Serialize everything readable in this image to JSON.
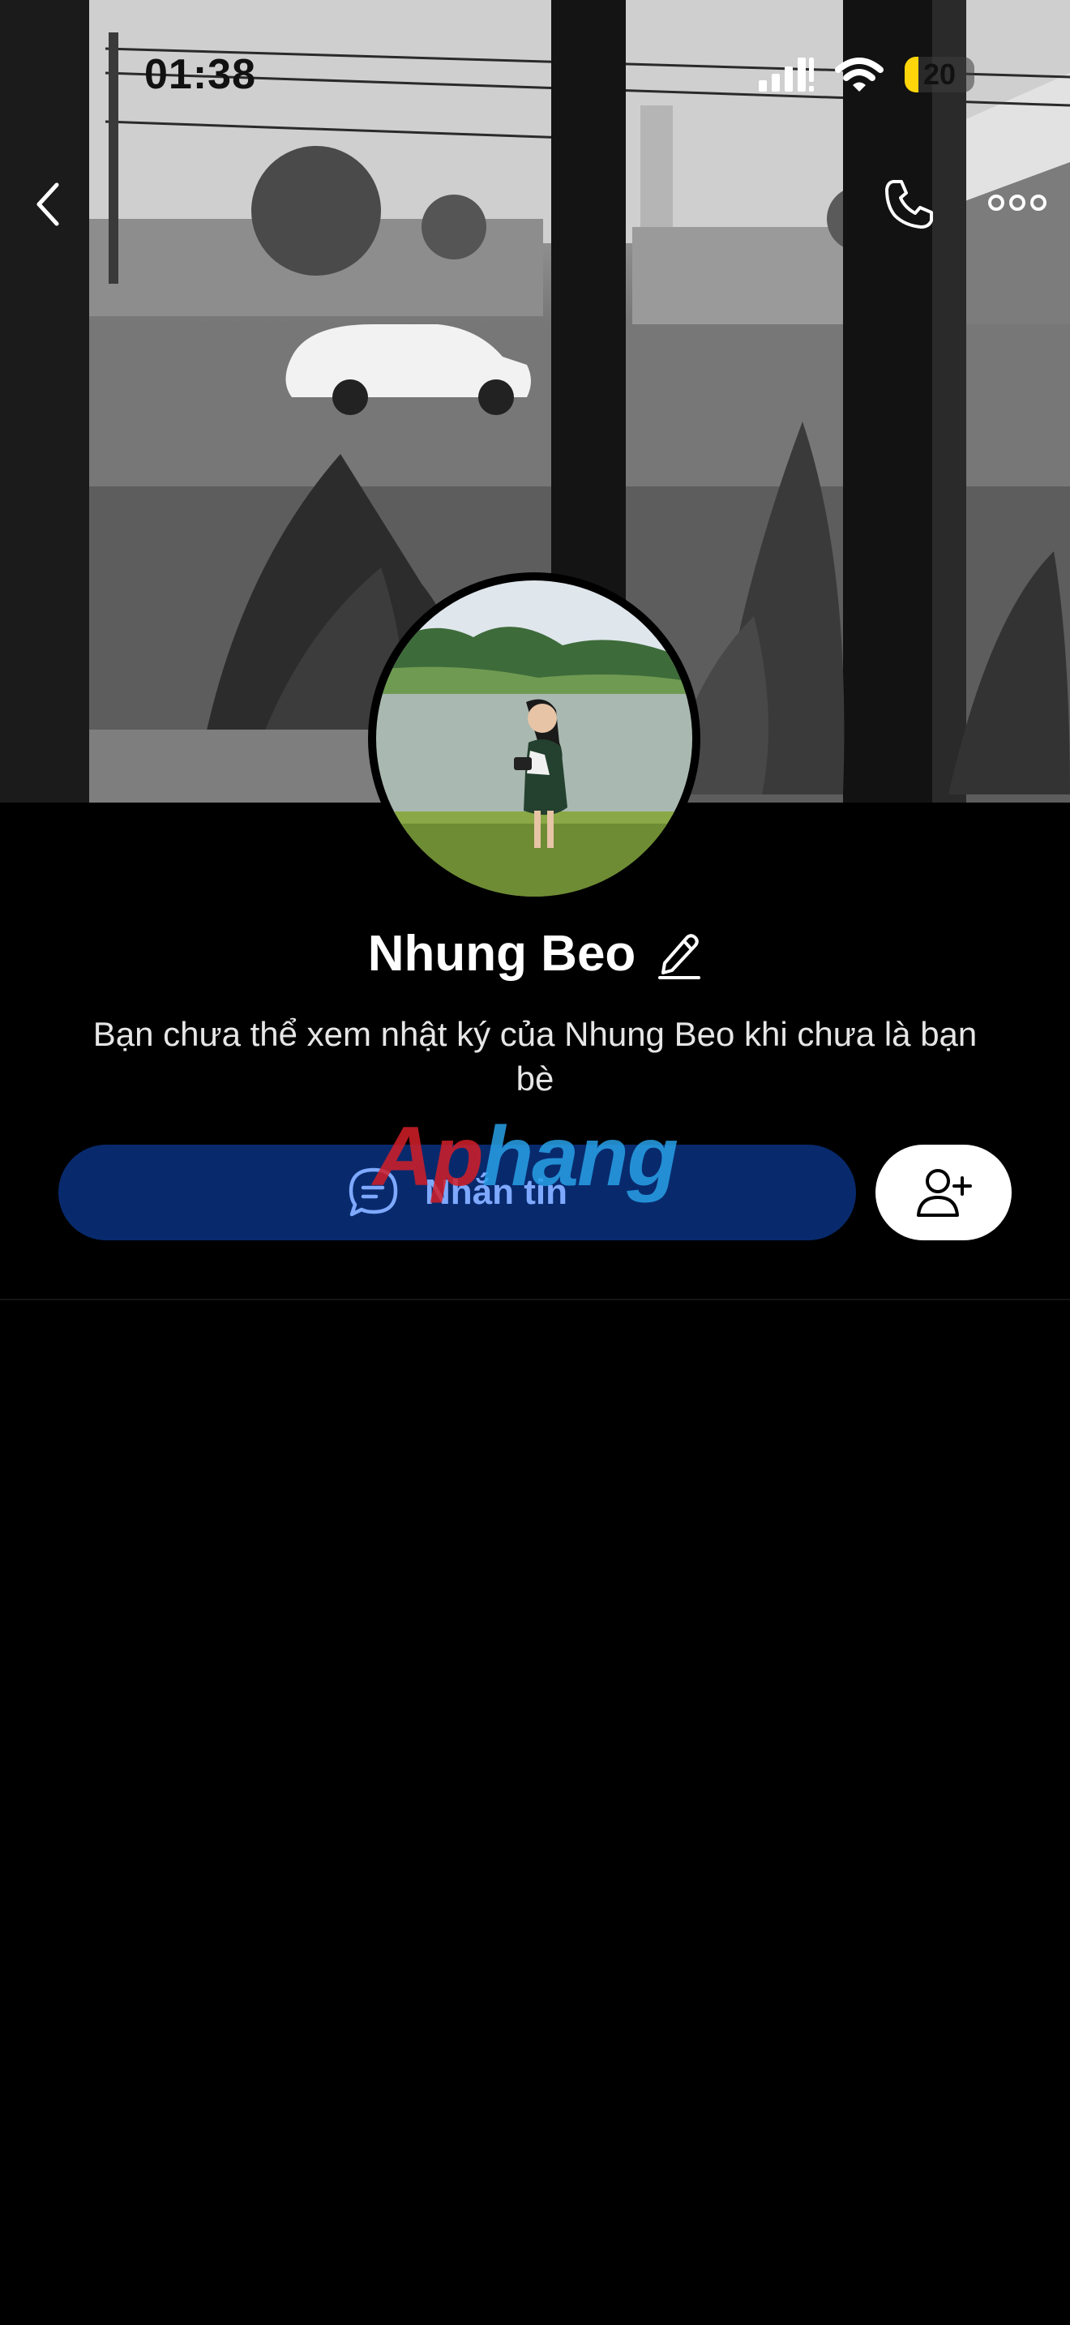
{
  "status_bar": {
    "time": "01:38",
    "battery_level": "20",
    "battery_fill_percent": 20,
    "battery_color": "#ffd60a",
    "signal_icon": "cellular-signal-icon",
    "wifi_icon": "wifi-icon"
  },
  "nav": {
    "back_icon": "chevron-left-icon",
    "call_icon": "phone-icon",
    "more_icon": "more-horizontal-icon"
  },
  "profile": {
    "name": "Nhung Beo",
    "edit_icon": "pencil-icon",
    "notice": "Bạn chưa thể xem nhật ký của Nhung Beo khi chưa là bạn bè"
  },
  "actions": {
    "message_label": "Nhắn tin",
    "message_icon": "chat-bubble-icon",
    "add_friend_icon": "add-friend-icon",
    "message_button_color": "#082a6d",
    "message_label_color": "#7ea9ff"
  },
  "watermark": {
    "part1": "Ap",
    "part2": "hang"
  }
}
